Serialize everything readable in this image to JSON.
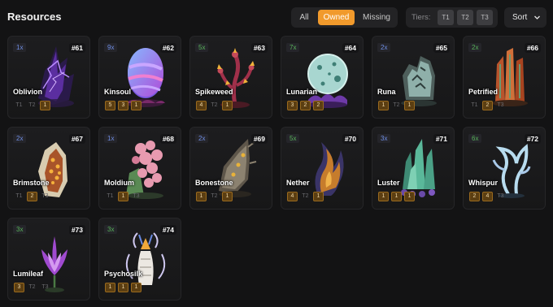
{
  "header": {
    "title": "Resources",
    "filters": [
      "All",
      "Owned",
      "Missing"
    ],
    "active_filter": "Owned",
    "tiers_label": "Tiers:",
    "tier_buttons": [
      "T1",
      "T2",
      "T3"
    ],
    "sort_label": "Sort"
  },
  "colors": {
    "accent": "#f19a2c",
    "tier_owned_bg": "#5b3e12",
    "background": "#131314"
  },
  "resources": [
    {
      "count": "1x",
      "number": "#61",
      "name": "Oblivion",
      "count_color": "#6f8fe6",
      "tiers": [
        {
          "label": "T1",
          "owned": false
        },
        {
          "label": "T2",
          "owned": false
        },
        {
          "label": "1",
          "owned": true
        }
      ]
    },
    {
      "count": "9x",
      "number": "#62",
      "name": "Kinsoul",
      "count_color": "#6f8fe6",
      "tiers": [
        {
          "label": "5",
          "owned": true
        },
        {
          "label": "3",
          "owned": true
        },
        {
          "label": "1",
          "owned": true
        }
      ]
    },
    {
      "count": "5x",
      "number": "#63",
      "name": "Spikeweed",
      "count_color": "#58b35a",
      "tiers": [
        {
          "label": "4",
          "owned": true
        },
        {
          "label": "T2",
          "owned": false
        },
        {
          "label": "1",
          "owned": true
        }
      ]
    },
    {
      "count": "7x",
      "number": "#64",
      "name": "Lunarian",
      "count_color": "#58b35a",
      "tiers": [
        {
          "label": "3",
          "owned": true
        },
        {
          "label": "2",
          "owned": true
        },
        {
          "label": "2",
          "owned": true
        }
      ]
    },
    {
      "count": "2x",
      "number": "#65",
      "name": "Runa",
      "count_color": "#6f8fe6",
      "tiers": [
        {
          "label": "1",
          "owned": true
        },
        {
          "label": "T2",
          "owned": false
        },
        {
          "label": "1",
          "owned": true
        }
      ]
    },
    {
      "count": "2x",
      "number": "#66",
      "name": "Petrified",
      "count_color": "#58b35a",
      "tiers": [
        {
          "label": "T1",
          "owned": false
        },
        {
          "label": "2",
          "owned": true
        },
        {
          "label": "T3",
          "owned": false
        }
      ]
    },
    {
      "count": "2x",
      "number": "#67",
      "name": "Brimstone",
      "count_color": "#6f8fe6",
      "tiers": [
        {
          "label": "T1",
          "owned": false
        },
        {
          "label": "2",
          "owned": true
        },
        {
          "label": "T3",
          "owned": false
        }
      ]
    },
    {
      "count": "1x",
      "number": "#68",
      "name": "Moldium",
      "count_color": "#6f8fe6",
      "tiers": [
        {
          "label": "T1",
          "owned": false
        },
        {
          "label": "1",
          "owned": true
        },
        {
          "label": "T3",
          "owned": false
        }
      ]
    },
    {
      "count": "2x",
      "number": "#69",
      "name": "Bonestone",
      "count_color": "#6f8fe6",
      "tiers": [
        {
          "label": "1",
          "owned": true
        },
        {
          "label": "T2",
          "owned": false
        },
        {
          "label": "1",
          "owned": true
        }
      ]
    },
    {
      "count": "5x",
      "number": "#70",
      "name": "Nether",
      "count_color": "#58b35a",
      "tiers": [
        {
          "label": "4",
          "owned": true
        },
        {
          "label": "T2",
          "owned": false
        },
        {
          "label": "1",
          "owned": true
        }
      ]
    },
    {
      "count": "3x",
      "number": "#71",
      "name": "Luster",
      "count_color": "#6f8fe6",
      "tiers": [
        {
          "label": "1",
          "owned": true
        },
        {
          "label": "1",
          "owned": true
        },
        {
          "label": "1",
          "owned": true
        }
      ]
    },
    {
      "count": "6x",
      "number": "#72",
      "name": "Whispur",
      "count_color": "#58b35a",
      "tiers": [
        {
          "label": "2",
          "owned": true
        },
        {
          "label": "4",
          "owned": true
        },
        {
          "label": "T3",
          "owned": false
        }
      ]
    },
    {
      "count": "3x",
      "number": "#73",
      "name": "Lumileaf",
      "count_color": "#58b35a",
      "tiers": [
        {
          "label": "3",
          "owned": true
        },
        {
          "label": "T2",
          "owned": false
        },
        {
          "label": "T3",
          "owned": false
        }
      ]
    },
    {
      "count": "3x",
      "number": "#74",
      "name": "Psychosilk",
      "count_color": "#58b35a",
      "tiers": [
        {
          "label": "1",
          "owned": true
        },
        {
          "label": "1",
          "owned": true
        },
        {
          "label": "1",
          "owned": true
        }
      ]
    }
  ]
}
